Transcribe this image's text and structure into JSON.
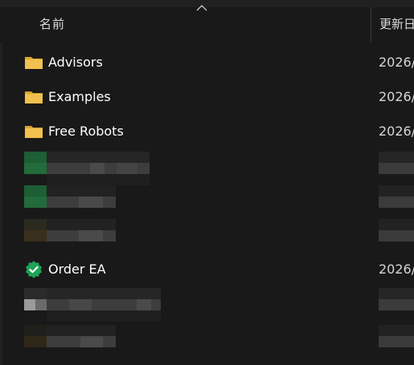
{
  "header": {
    "name_label": "名前",
    "date_label": "更新日"
  },
  "rows": [
    {
      "name": "Advisors",
      "date": "2026/",
      "icon": "folder-icon"
    },
    {
      "name": "Examples",
      "date": "2026/",
      "icon": "folder-icon"
    },
    {
      "name": "Free Robots",
      "date": "2026/",
      "icon": "folder-icon"
    },
    {
      "name": "Order EA",
      "date": "2026/",
      "icon": "verified-badge-icon"
    }
  ],
  "colors": {
    "background": "#191919",
    "folder": "#f2c04e",
    "badge": "#1fa354"
  }
}
